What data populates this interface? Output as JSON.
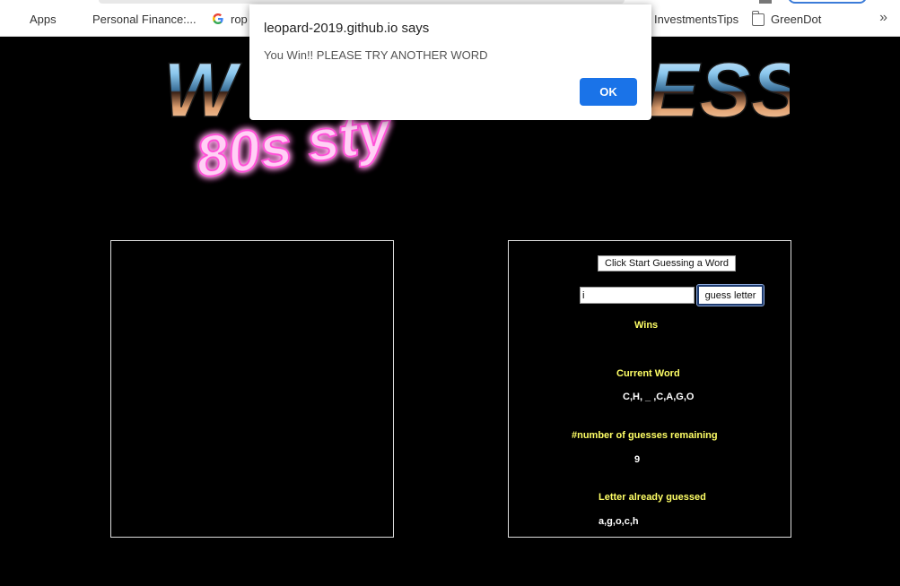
{
  "bookmarks": {
    "items": [
      {
        "label": "Apps",
        "icon": "apps-grid-icon"
      },
      {
        "label": "Personal Finance:...",
        "icon": "books-icon"
      },
      {
        "label": "rop",
        "icon": "google-icon"
      },
      {
        "label": "InvestmentsTips",
        "icon": "none"
      },
      {
        "label": "GreenDot",
        "icon": "folder-icon"
      }
    ],
    "more_label": "»"
  },
  "logo": {
    "title_left": "W",
    "title_right": "ESS",
    "subtitle": "80s sty"
  },
  "game": {
    "start_button_label": "Click Start Guessing a Word",
    "guess_input_value": "i",
    "guess_button_label": "guess letter",
    "wins_label": "Wins",
    "wins_value": "",
    "current_word_label": "Current Word",
    "current_word_value": "C,H, _ ,C,A,G,O",
    "guesses_remaining_label": "#number of guesses remaining",
    "guesses_remaining_value": "9",
    "letters_guessed_label": "Letter already guessed",
    "letters_guessed_value": "a,g,o,c,h"
  },
  "dialog": {
    "title": "leopard-2019.github.io says",
    "message": "You Win!! PLEASE TRY ANOTHER WORD",
    "ok_label": "OK"
  },
  "colors": {
    "label_yellow": "#ffff66",
    "ok_blue": "#1a73e8",
    "neon_pink": "#ff4fd8"
  }
}
